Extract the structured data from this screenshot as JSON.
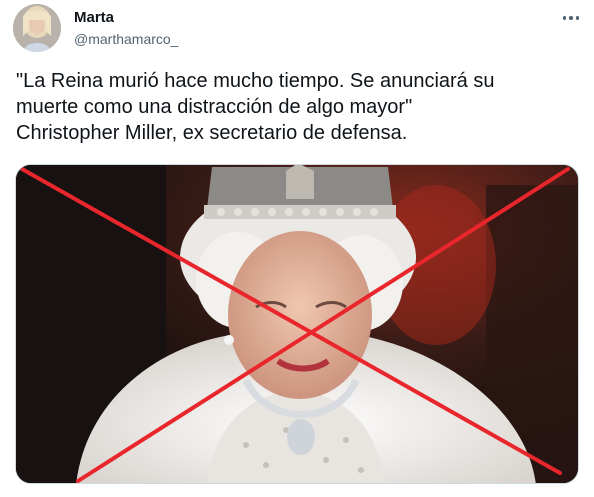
{
  "author": {
    "display_name": "Marta",
    "handle": "@marthamarco_"
  },
  "tweet": {
    "text": "\"La Reina murió hace mucho tiempo. Se anunciará su\nmuerte como una distracción de algo mayor\"\nChristopher Miller, ex secretario de defensa."
  },
  "icons": {
    "more": "more-dots-icon",
    "cross": "red-x-mark"
  },
  "colors": {
    "text": "#0f1419",
    "secondary": "#536471",
    "cross": "#e8262b"
  }
}
